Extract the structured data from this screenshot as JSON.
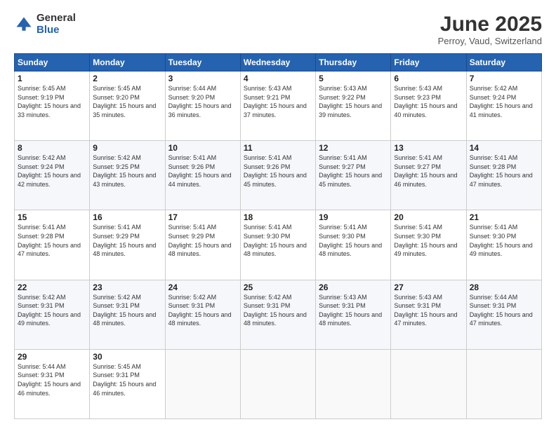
{
  "logo": {
    "general": "General",
    "blue": "Blue"
  },
  "header": {
    "title": "June 2025",
    "subtitle": "Perroy, Vaud, Switzerland"
  },
  "calendar": {
    "days_of_week": [
      "Sunday",
      "Monday",
      "Tuesday",
      "Wednesday",
      "Thursday",
      "Friday",
      "Saturday"
    ],
    "weeks": [
      [
        null,
        {
          "day": "2",
          "sunrise": "Sunrise: 5:45 AM",
          "sunset": "Sunset: 9:20 PM",
          "daylight": "Daylight: 15 hours and 35 minutes."
        },
        {
          "day": "3",
          "sunrise": "Sunrise: 5:44 AM",
          "sunset": "Sunset: 9:20 PM",
          "daylight": "Daylight: 15 hours and 36 minutes."
        },
        {
          "day": "4",
          "sunrise": "Sunrise: 5:43 AM",
          "sunset": "Sunset: 9:21 PM",
          "daylight": "Daylight: 15 hours and 37 minutes."
        },
        {
          "day": "5",
          "sunrise": "Sunrise: 5:43 AM",
          "sunset": "Sunset: 9:22 PM",
          "daylight": "Daylight: 15 hours and 39 minutes."
        },
        {
          "day": "6",
          "sunrise": "Sunrise: 5:43 AM",
          "sunset": "Sunset: 9:23 PM",
          "daylight": "Daylight: 15 hours and 40 minutes."
        },
        {
          "day": "7",
          "sunrise": "Sunrise: 5:42 AM",
          "sunset": "Sunset: 9:24 PM",
          "daylight": "Daylight: 15 hours and 41 minutes."
        }
      ],
      [
        {
          "day": "1",
          "sunrise": "Sunrise: 5:45 AM",
          "sunset": "Sunset: 9:19 PM",
          "daylight": "Daylight: 15 hours and 33 minutes."
        },
        null,
        null,
        null,
        null,
        null,
        null
      ],
      [
        {
          "day": "8",
          "sunrise": "Sunrise: 5:42 AM",
          "sunset": "Sunset: 9:24 PM",
          "daylight": "Daylight: 15 hours and 42 minutes."
        },
        {
          "day": "9",
          "sunrise": "Sunrise: 5:42 AM",
          "sunset": "Sunset: 9:25 PM",
          "daylight": "Daylight: 15 hours and 43 minutes."
        },
        {
          "day": "10",
          "sunrise": "Sunrise: 5:41 AM",
          "sunset": "Sunset: 9:26 PM",
          "daylight": "Daylight: 15 hours and 44 minutes."
        },
        {
          "day": "11",
          "sunrise": "Sunrise: 5:41 AM",
          "sunset": "Sunset: 9:26 PM",
          "daylight": "Daylight: 15 hours and 45 minutes."
        },
        {
          "day": "12",
          "sunrise": "Sunrise: 5:41 AM",
          "sunset": "Sunset: 9:27 PM",
          "daylight": "Daylight: 15 hours and 45 minutes."
        },
        {
          "day": "13",
          "sunrise": "Sunrise: 5:41 AM",
          "sunset": "Sunset: 9:27 PM",
          "daylight": "Daylight: 15 hours and 46 minutes."
        },
        {
          "day": "14",
          "sunrise": "Sunrise: 5:41 AM",
          "sunset": "Sunset: 9:28 PM",
          "daylight": "Daylight: 15 hours and 47 minutes."
        }
      ],
      [
        {
          "day": "15",
          "sunrise": "Sunrise: 5:41 AM",
          "sunset": "Sunset: 9:28 PM",
          "daylight": "Daylight: 15 hours and 47 minutes."
        },
        {
          "day": "16",
          "sunrise": "Sunrise: 5:41 AM",
          "sunset": "Sunset: 9:29 PM",
          "daylight": "Daylight: 15 hours and 48 minutes."
        },
        {
          "day": "17",
          "sunrise": "Sunrise: 5:41 AM",
          "sunset": "Sunset: 9:29 PM",
          "daylight": "Daylight: 15 hours and 48 minutes."
        },
        {
          "day": "18",
          "sunrise": "Sunrise: 5:41 AM",
          "sunset": "Sunset: 9:30 PM",
          "daylight": "Daylight: 15 hours and 48 minutes."
        },
        {
          "day": "19",
          "sunrise": "Sunrise: 5:41 AM",
          "sunset": "Sunset: 9:30 PM",
          "daylight": "Daylight: 15 hours and 48 minutes."
        },
        {
          "day": "20",
          "sunrise": "Sunrise: 5:41 AM",
          "sunset": "Sunset: 9:30 PM",
          "daylight": "Daylight: 15 hours and 49 minutes."
        },
        {
          "day": "21",
          "sunrise": "Sunrise: 5:41 AM",
          "sunset": "Sunset: 9:30 PM",
          "daylight": "Daylight: 15 hours and 49 minutes."
        }
      ],
      [
        {
          "day": "22",
          "sunrise": "Sunrise: 5:42 AM",
          "sunset": "Sunset: 9:31 PM",
          "daylight": "Daylight: 15 hours and 49 minutes."
        },
        {
          "day": "23",
          "sunrise": "Sunrise: 5:42 AM",
          "sunset": "Sunset: 9:31 PM",
          "daylight": "Daylight: 15 hours and 48 minutes."
        },
        {
          "day": "24",
          "sunrise": "Sunrise: 5:42 AM",
          "sunset": "Sunset: 9:31 PM",
          "daylight": "Daylight: 15 hours and 48 minutes."
        },
        {
          "day": "25",
          "sunrise": "Sunrise: 5:42 AM",
          "sunset": "Sunset: 9:31 PM",
          "daylight": "Daylight: 15 hours and 48 minutes."
        },
        {
          "day": "26",
          "sunrise": "Sunrise: 5:43 AM",
          "sunset": "Sunset: 9:31 PM",
          "daylight": "Daylight: 15 hours and 48 minutes."
        },
        {
          "day": "27",
          "sunrise": "Sunrise: 5:43 AM",
          "sunset": "Sunset: 9:31 PM",
          "daylight": "Daylight: 15 hours and 47 minutes."
        },
        {
          "day": "28",
          "sunrise": "Sunrise: 5:44 AM",
          "sunset": "Sunset: 9:31 PM",
          "daylight": "Daylight: 15 hours and 47 minutes."
        }
      ],
      [
        {
          "day": "29",
          "sunrise": "Sunrise: 5:44 AM",
          "sunset": "Sunset: 9:31 PM",
          "daylight": "Daylight: 15 hours and 46 minutes."
        },
        {
          "day": "30",
          "sunrise": "Sunrise: 5:45 AM",
          "sunset": "Sunset: 9:31 PM",
          "daylight": "Daylight: 15 hours and 46 minutes."
        },
        null,
        null,
        null,
        null,
        null
      ]
    ]
  }
}
